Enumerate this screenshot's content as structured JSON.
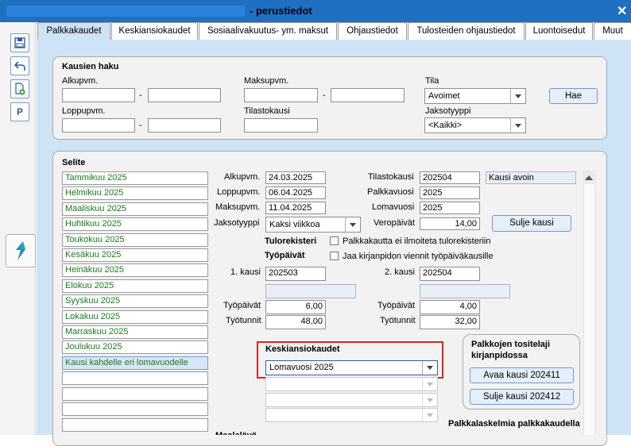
{
  "window": {
    "title": "- perustiedot"
  },
  "tabs": [
    {
      "label": "Palkkakaudet"
    },
    {
      "label": "Keskiansiokaudet"
    },
    {
      "label": "Sosiaalivakuutus- ym. maksut"
    },
    {
      "label": "Ohjaustiedot"
    },
    {
      "label": "Tulosteiden ohjaustiedot"
    },
    {
      "label": "Luontoisedut"
    },
    {
      "label": "Muut"
    }
  ],
  "search": {
    "heading": "Kausien haku",
    "alkupvm_label": "Alkupvm.",
    "loppupvm_label": "Loppupvm.",
    "maksupvm_label": "Maksupvm.",
    "tilastokausi_label": "Tilastokausi",
    "tila_label": "Tila",
    "tila_value": "Avoimet",
    "jaksotyyppi_label": "Jaksotyyppi",
    "jaksotyyppi_value": "<Kaikki>",
    "dash": "-",
    "hae_label": "Hae"
  },
  "periods": {
    "heading": "Selite",
    "items": [
      "Tammikuu 2025",
      "Helmikuu 2025",
      "Maaliskuu 2025",
      "Huhtikuu 2025",
      "Toukokuu 2025",
      "Kesäkuu 2025",
      "Heinäkuu 2025",
      "Elokuu 2025",
      "Syyskuu 2025",
      "Lokakuu 2025",
      "Marraskuu 2025",
      "Joulukuu 2025",
      "Kausi kahdelle eri lomavuodelle"
    ]
  },
  "detail": {
    "alkupvm_label": "Alkupvm.",
    "alkupvm": "24.03.2025",
    "loppupvm_label": "Loppupvm.",
    "loppupvm": "06.04.2025",
    "maksupvm_label": "Maksupvm.",
    "maksupvm": "11.04.2025",
    "jaksotyyppi_label": "Jaksotyyppi",
    "jaksotyyppi": "Kaksi viikkoa",
    "tilastokausi_label": "Tilastokausi",
    "tilastokausi": "202504",
    "tila_status": "Kausi avoin",
    "palkkavuosi_label": "Palkkavuosi",
    "palkkavuosi": "2025",
    "lomavuosi_label": "Lomavuosi",
    "lomavuosi": "2025",
    "veropaivat_label": "Veropäivät",
    "veropaivat": "14,00",
    "sulje_kausi_label": "Sulje kausi",
    "tulorekisteri_label": "Tulorekisteri",
    "tulorekisteri_check": "Palkkakautta ei ilmoiteta tulorekisteriin",
    "tyopaivat_heading": "Työpäivät",
    "tyopaivat_check": "Jaa kirjanpidon viennit työpäiväkausille",
    "kausi1_label": "1. kausi",
    "kausi1": "202503",
    "kausi2_label": "2. kausi",
    "kausi2": "202504",
    "tyopaivat_label": "Työpäivät",
    "tyopaivat1": "6,00",
    "tyopaivat2": "4,00",
    "tyotunnit_label": "Työtunnit",
    "tyotunnit1": "48,00",
    "tyotunnit2": "32,00"
  },
  "keskiansio": {
    "heading": "Keskiansiokaudet",
    "value": "Lomavuosi 2025"
  },
  "tositelaji": {
    "heading": "Palkkojen tositelaji kirjanpidossa",
    "avaa_label": "Avaa kausi 202411",
    "sulje_label": "Sulje kausi 202412"
  },
  "footer": {
    "palkkalaskelmia": "Palkkalaskelmia palkkakaudella",
    "cut_label": "Maalalävä..."
  },
  "colors": {
    "titlebar": "#1f6fc2",
    "panel": "#cfe3f6",
    "highlight_border": "#e02020",
    "list_text": "#1a7a1a"
  }
}
